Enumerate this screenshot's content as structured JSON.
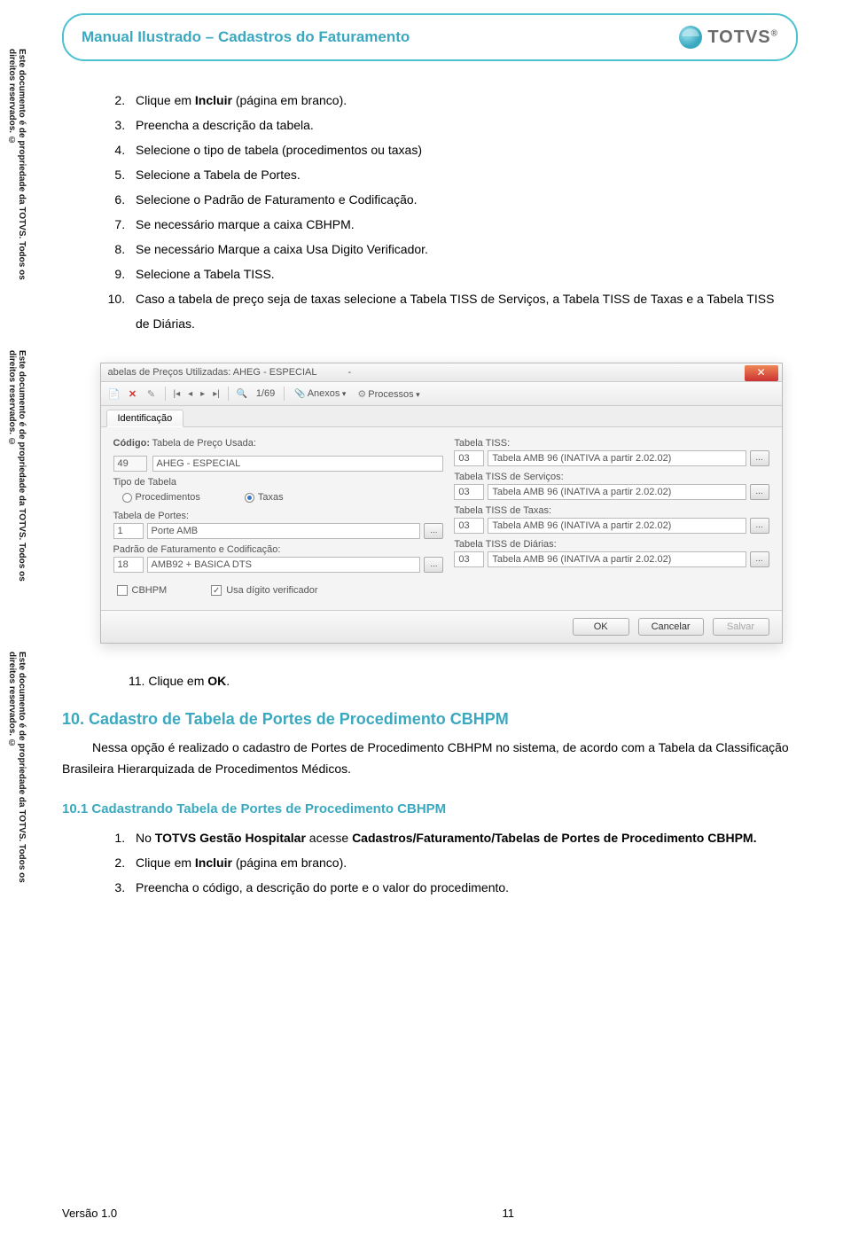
{
  "side_text": "Este documento é de propriedade da TOTVS. Todos os direitos reservados. ©",
  "header": {
    "title": "Manual Ilustrado – Cadastros do Faturamento",
    "logo": "TOTVS"
  },
  "steps_a_start": 2,
  "steps_a": [
    {
      "pre": "Clique em ",
      "bold": "Incluir",
      "post": " (página em branco)."
    },
    {
      "pre": "Preencha a descrição da tabela.",
      "bold": "",
      "post": ""
    },
    {
      "pre": "Selecione o tipo de tabela (procedimentos ou taxas)",
      "bold": "",
      "post": ""
    },
    {
      "pre": "Selecione a Tabela de Portes.",
      "bold": "",
      "post": ""
    },
    {
      "pre": "Selecione o Padrão de Faturamento e Codificação.",
      "bold": "",
      "post": ""
    },
    {
      "pre": "Se necessário marque a caixa CBHPM.",
      "bold": "",
      "post": ""
    },
    {
      "pre": "Se necessário Marque a caixa Usa Digito Verificador.",
      "bold": "",
      "post": ""
    },
    {
      "pre": "Selecione a Tabela TISS.",
      "bold": "",
      "post": ""
    },
    {
      "pre": "Caso a tabela de preço seja de taxas selecione a Tabela TISS de Serviços, a Tabela TISS de Taxas e a Tabela TISS de Diárias.",
      "bold": "",
      "post": ""
    }
  ],
  "screenshot": {
    "title": "abelas de Preços Utilizadas: AHEG - ESPECIAL",
    "toolbar": {
      "page": "1/69",
      "anexos": "Anexos",
      "processos": "Processos"
    },
    "tab": "Identificação",
    "left": {
      "codigo_lbl": "Código:",
      "tabela_lbl": "Tabela de Preço Usada:",
      "codigo": "49",
      "tabela": "AHEG - ESPECIAL",
      "tipo_lbl": "Tipo de Tabela",
      "proc": "Procedimentos",
      "taxas": "Taxas",
      "portes_lbl": "Tabela de Portes:",
      "portes_code": "1",
      "portes_desc": "Porte AMB",
      "padrao_lbl": "Padrão de Faturamento e Codificação:",
      "padrao_code": "18",
      "padrao_desc": "AMB92 + BASICA DTS",
      "cbhpm": "CBHPM",
      "digito": "Usa dígito verificador"
    },
    "right": {
      "tiss_lbl": "Tabela TISS:",
      "serv_lbl": "Tabela TISS de Serviços:",
      "taxas_lbl": "Tabela TISS de Taxas:",
      "diarias_lbl": "Tabela TISS de Diárias:",
      "code": "03",
      "desc": "Tabela AMB 96 (INATIVA a partir 2.02.02)"
    },
    "buttons": {
      "ok": "OK",
      "cancel": "Cancelar",
      "save": "Salvar"
    }
  },
  "step11": {
    "num": "11.",
    "pre": "Clique em ",
    "bold": "OK",
    "post": "."
  },
  "section10": {
    "heading": "10. Cadastro de Tabela de Portes de Procedimento CBHPM",
    "para": "Nessa opção é realizado o cadastro de Portes de Procedimento CBHPM no sistema, de acordo com a Tabela da Classificação Brasileira Hierarquizada de Procedimentos Médicos."
  },
  "section101": {
    "heading": "10.1 Cadastrando Tabela de Portes de Procedimento CBHPM",
    "steps": [
      {
        "p1": "No ",
        "b1": "TOTVS Gestão Hospitalar",
        "p2": " acesse ",
        "b2": "Cadastros/Faturamento/Tabelas de Portes de Procedimento CBHPM.",
        "p3": ""
      },
      {
        "p1": "Clique em ",
        "b1": "Incluir",
        "p2": " (página em branco).",
        "b2": "",
        "p3": ""
      },
      {
        "p1": "Preencha o código, a descrição do porte e o valor do procedimento.",
        "b1": "",
        "p2": "",
        "b2": "",
        "p3": ""
      }
    ]
  },
  "footer": {
    "version": "Versão 1.0",
    "page": "11"
  }
}
